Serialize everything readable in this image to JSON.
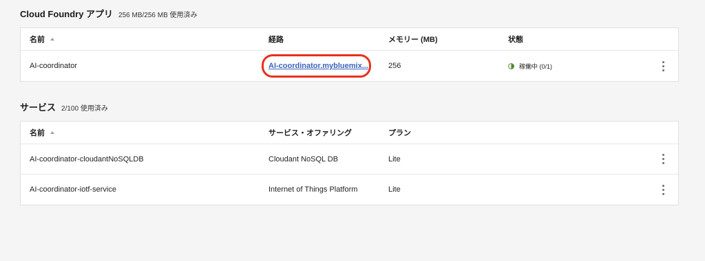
{
  "apps": {
    "title": "Cloud Foundry アプリ",
    "usage": "256 MB/256 MB 使用済み",
    "columns": [
      "名前",
      "経路",
      "メモリー (MB)",
      "状態"
    ],
    "rows": [
      {
        "name": "AI-coordinator",
        "route": "AI-coordinator.mybluemix...",
        "memory": "256",
        "status": "稼働中 (0/1)"
      }
    ]
  },
  "services": {
    "title": "サービス",
    "usage": "2/100 使用済み",
    "columns": [
      "名前",
      "サービス・オファリング",
      "プラン"
    ],
    "rows": [
      {
        "name": "AI-coordinator-cloudantNoSQLDB",
        "offering": "Cloudant NoSQL DB",
        "plan": "Lite"
      },
      {
        "name": "AI-coordinator-iotf-service",
        "offering": "Internet of Things Platform",
        "plan": "Lite"
      }
    ]
  },
  "colors": {
    "highlight": "#e8301c",
    "link": "#3b63b8",
    "status": "#3f8f2d"
  },
  "icons": {
    "sort": "sort-ascending-icon",
    "status": "partial-running-icon",
    "overflow": "overflow-menu-icon"
  }
}
